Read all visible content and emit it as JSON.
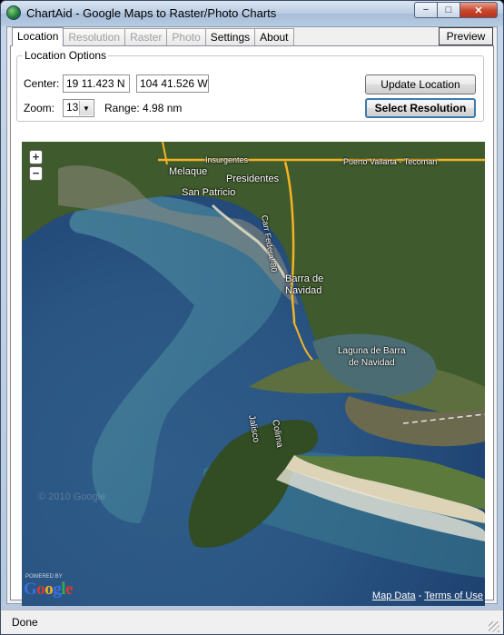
{
  "window": {
    "title": "ChartAid - Google Maps to Raster/Photo Charts",
    "controls": {
      "minimize": "−",
      "maximize": "□",
      "close": "✕"
    }
  },
  "tabs": [
    {
      "label": "Location",
      "state": "active"
    },
    {
      "label": "Resolution",
      "state": "disabled"
    },
    {
      "label": "Raster",
      "state": "disabled"
    },
    {
      "label": "Photo",
      "state": "disabled"
    },
    {
      "label": "Settings",
      "state": "normal"
    },
    {
      "label": "About",
      "state": "normal"
    }
  ],
  "preview_label": "Preview",
  "location_options": {
    "legend": "Location Options",
    "center_label": "Center:",
    "latitude": "19 11.423 N",
    "longitude": "104 41.526 W",
    "zoom_label": "Zoom:",
    "zoom_value": "13",
    "range_text": "Range: 4.98 nm",
    "update_label": "Update Location",
    "select_label": "Select Resolution"
  },
  "map": {
    "zoom_in": "+",
    "zoom_out": "−",
    "labels": {
      "melaque": "Melaque",
      "insurgentes": "Insurgentes",
      "presidentes": "Presidentes",
      "san_patricio": "San Patricio",
      "carr_federal": "Carr Federal-80",
      "puerto_vallarta": "Puerto Vallarta - Tecoman",
      "barra_de_navidad": "Barra de",
      "barra_de_navidad_2": "Navidad",
      "laguna": "Laguna de Barra",
      "laguna_2": "de Navidad",
      "jalisco": "Jalisco",
      "colima": "Colima",
      "watermark": "© 2010 Google"
    },
    "powered_by": "POWERED BY",
    "logo": "Google",
    "map_data_link": "Map Data",
    "separator": " - ",
    "terms_link": "Terms of Use",
    "colors": {
      "ocean_deep": "#24487a",
      "ocean_shallow": "#3e7f99",
      "land": "#3f5a2c",
      "road": "#f2b327"
    }
  },
  "status": {
    "text": "Done"
  }
}
